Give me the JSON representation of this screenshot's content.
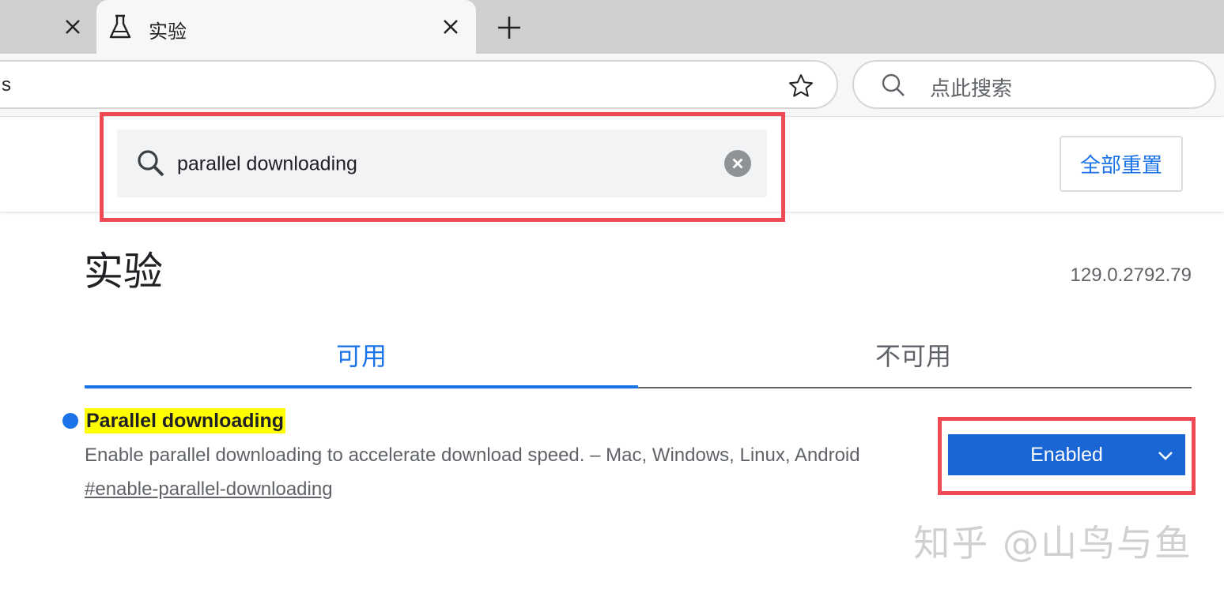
{
  "browser": {
    "active_tab_title": "实验",
    "address_text": "s",
    "search_placeholder": "点此搜索"
  },
  "flags": {
    "search_value": "parallel downloading",
    "reset_label": "全部重置",
    "page_title": "实验",
    "version": "129.0.2792.79",
    "tabs": [
      {
        "label": "可用"
      },
      {
        "label": "不可用"
      }
    ],
    "experiment": {
      "name": "Parallel downloading",
      "description": "Enable parallel downloading to accelerate download speed. – Mac, Windows, Linux, Android",
      "link": "#enable-parallel-downloading",
      "selected": "Enabled"
    }
  },
  "watermark": "知乎 @山鸟与鱼",
  "colors": {
    "accent": "#1a73e8",
    "highlight_border": "#ee4a54",
    "name_highlight": "#ffff00"
  }
}
